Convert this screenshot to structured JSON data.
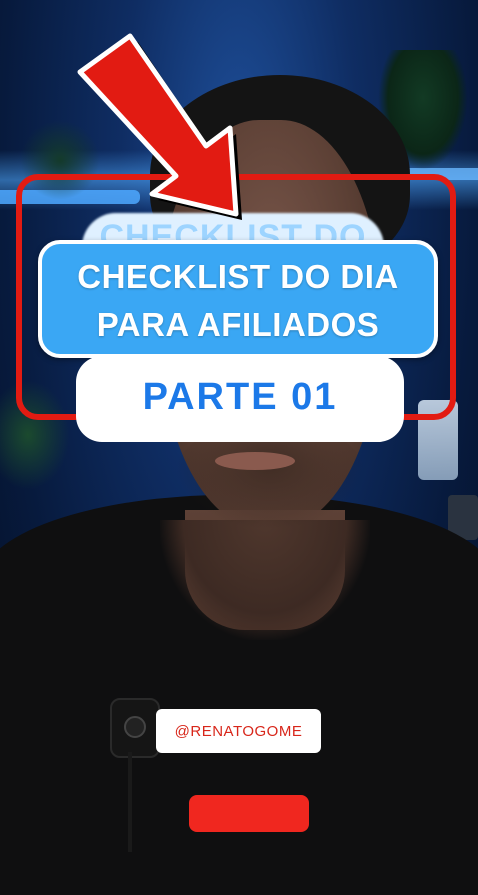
{
  "overlay": {
    "headline_line1": "CHECKLIST DO DIA",
    "headline_line2": "PARA AFILIADOS",
    "part_label": "PARTE 01",
    "blurred_background_text": "CHECKLIST DO"
  },
  "creator": {
    "handle": "@RENATOGOME"
  },
  "colors": {
    "frame_red": "#e21b12",
    "card_blue": "#3aa7f4",
    "part_text_blue": "#1c79e8",
    "handle_text_red": "#d8261a",
    "button_red": "#f0271f"
  },
  "icons": {
    "pointer": "red-arrow-icon",
    "microphone": "lapel-mic-icon"
  }
}
